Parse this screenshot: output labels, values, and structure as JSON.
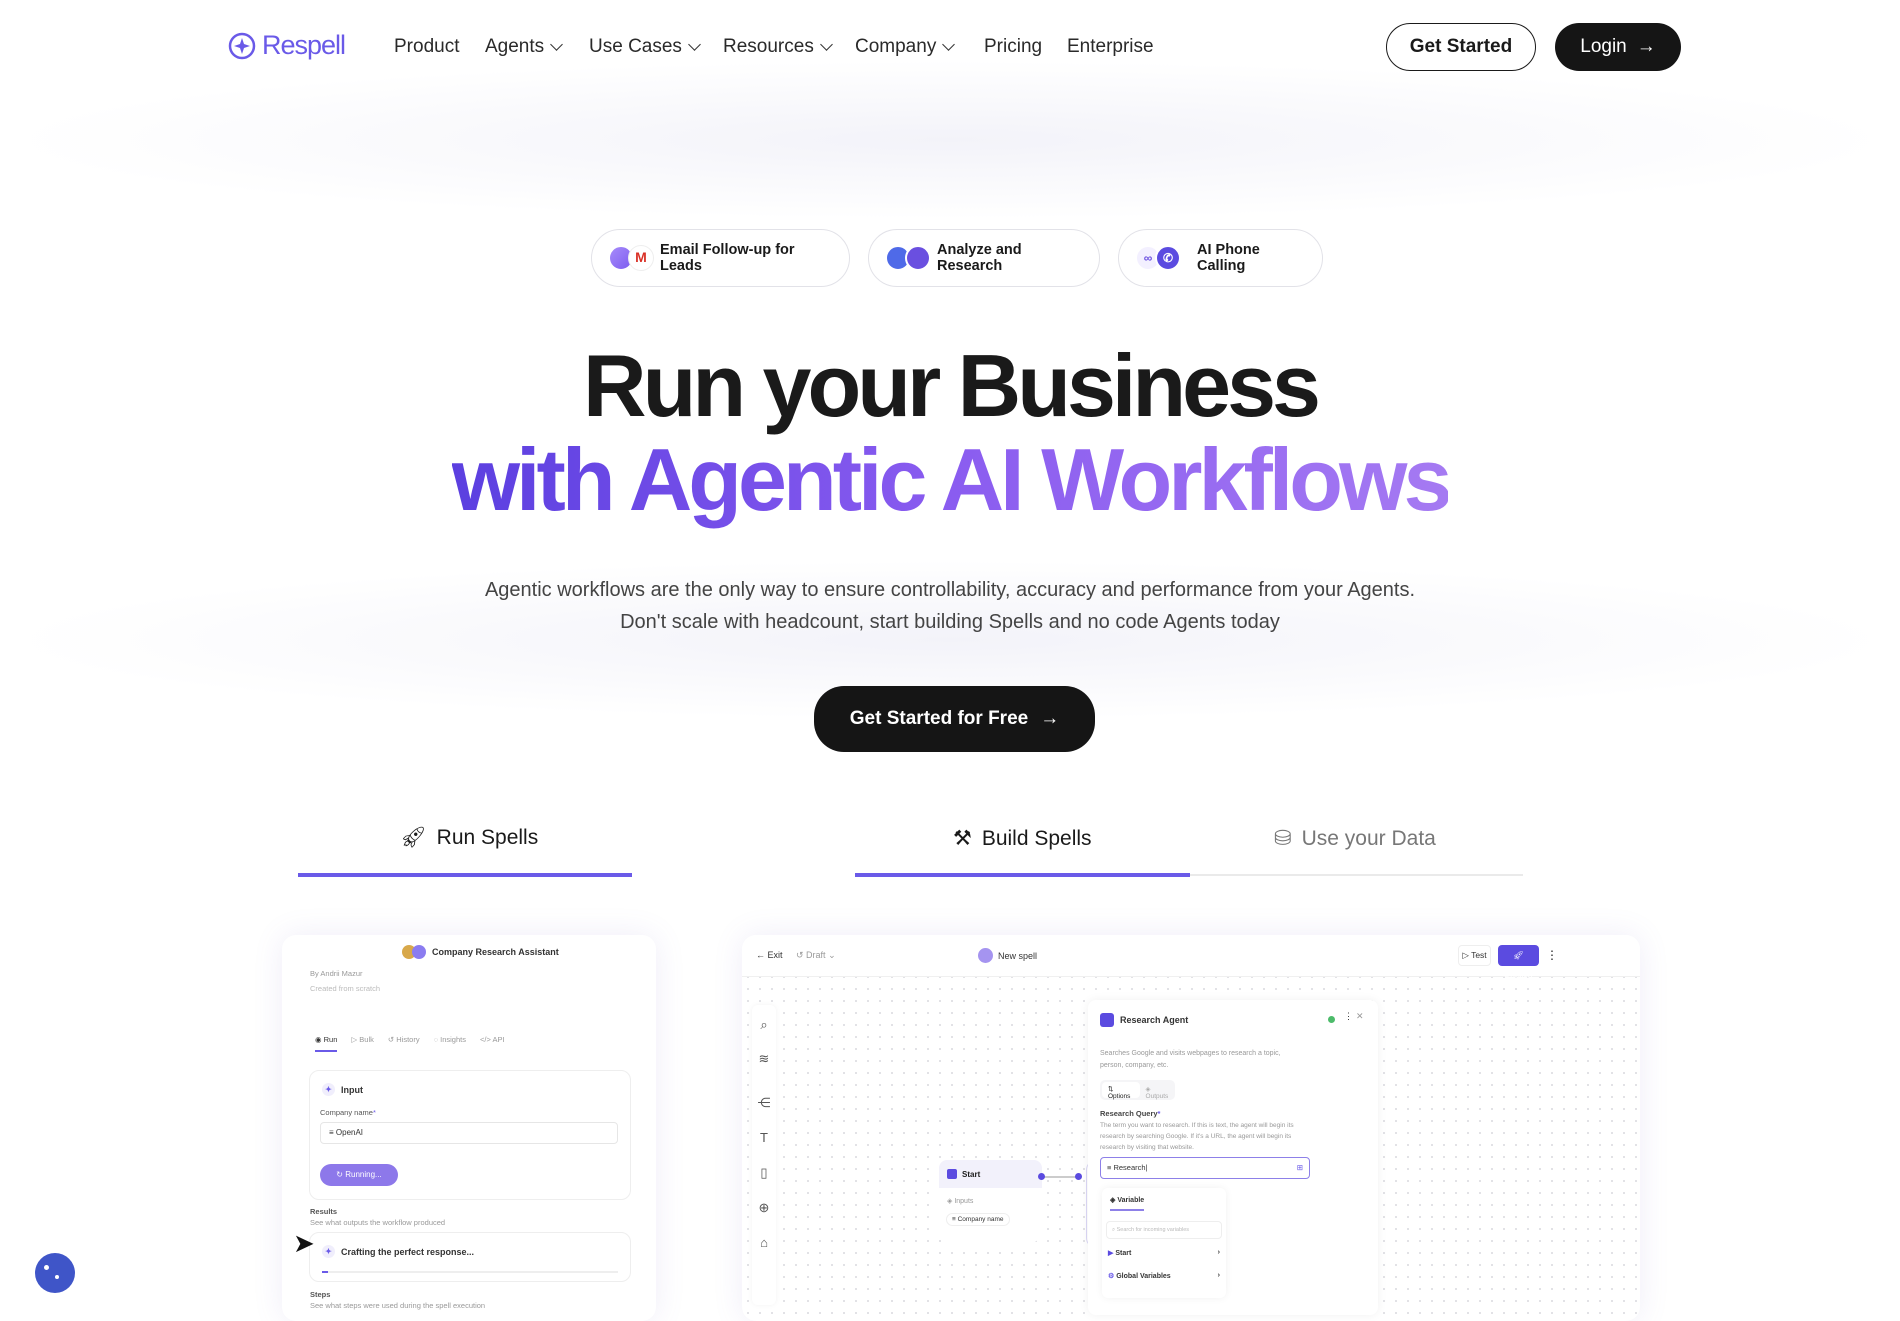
{
  "nav": {
    "logo": "Respell",
    "links": [
      {
        "label": "Product",
        "dropdown": false
      },
      {
        "label": "Agents",
        "dropdown": true
      },
      {
        "label": "Use Cases",
        "dropdown": true
      },
      {
        "label": "Resources",
        "dropdown": true
      },
      {
        "label": "Company",
        "dropdown": true
      },
      {
        "label": "Pricing",
        "dropdown": false
      },
      {
        "label": "Enterprise",
        "dropdown": false
      }
    ],
    "get_started": "Get Started",
    "login": "Login"
  },
  "pills": [
    {
      "label": "Email Follow-up for Leads",
      "icons": [
        "sparkle-icon",
        "gmail-icon"
      ]
    },
    {
      "label": "Analyze and Research",
      "icons": [
        "list-search-icon",
        "search-icon"
      ]
    },
    {
      "label": "AI Phone Calling",
      "icons": [
        "link-icon",
        "phone-icon"
      ]
    }
  ],
  "hero": {
    "line1": "Run your Business",
    "line2": "with Agentic AI Workflows",
    "desc1": "Agentic workflows are the only way to ensure controllability, accuracy and performance from your Agents.",
    "desc2": "Don't scale with headcount, start building Spells and no code Agents today",
    "cta": "Get Started for Free"
  },
  "tabs": [
    {
      "label": "Run Spells",
      "icon": "rocket-icon"
    },
    {
      "label": "Build Spells",
      "icon": "hammer-icon"
    },
    {
      "label": "Use your Data",
      "icon": "database-icon"
    }
  ],
  "run_panel": {
    "title": "Company Research Assistant",
    "author": "By Andrii Mazur",
    "origin": "Created from scratch",
    "tabs": [
      "Run",
      "Bulk",
      "History",
      "Insights",
      "API"
    ],
    "input_title": "Input",
    "field_label": "Company name",
    "field_value": "OpenAI",
    "running": "Running...",
    "results_title": "Results",
    "results_desc": "See what outputs the workflow produced",
    "crafting": "Crafting the perfect response...",
    "progress_percent": 2,
    "steps_title": "Steps",
    "steps_desc": "See what steps were used during the spell execution"
  },
  "build_panel": {
    "exit": "Exit",
    "draft": "Draft",
    "spell_name": "New spell",
    "test": "Test",
    "publish": "Publish",
    "start_node": "Start",
    "inputs": "Inputs",
    "company_name": "Company name",
    "agent": {
      "title": "Research Agent",
      "desc": "Searches Google and visits webpages to research a topic, person, company, etc.",
      "tab_options": "Options",
      "tab_outputs": "Outputs",
      "query_label": "Research Query",
      "query_desc": "The term you want to research. If this is text, the agent will begin its research by searching Google. If it's a URL, the agent will begin its research by visiting that website.",
      "query_value": "Research",
      "variable_tab": "Variable",
      "search_placeholder": "Search for incoming variables",
      "items": [
        "Start",
        "Global Variables"
      ]
    }
  },
  "colors": {
    "accent": "#6a5ae8",
    "dark": "#151515",
    "purple": "#8b5cf6"
  }
}
